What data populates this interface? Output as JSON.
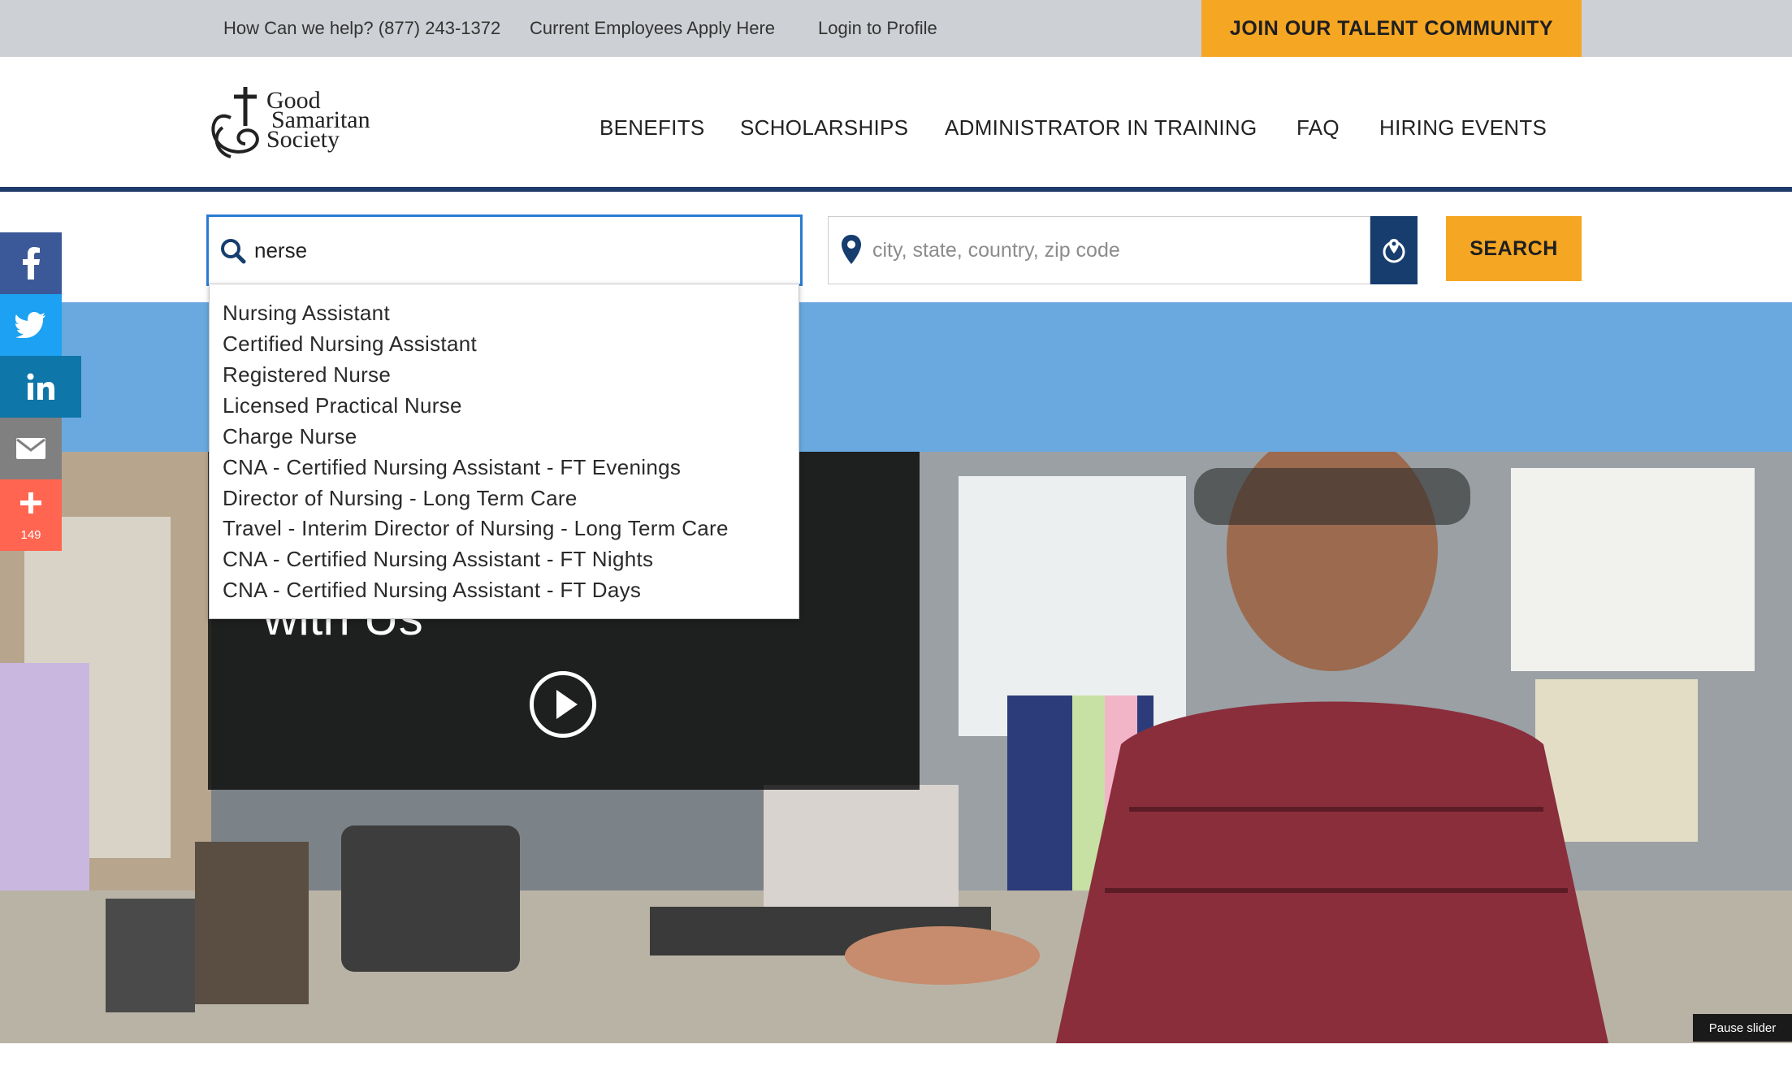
{
  "utility_bar": {
    "help_text": "How Can we help? (877) 243-1372",
    "employees_link": "Current Employees Apply Here",
    "login_link": "Login to Profile",
    "join_button": "JOIN OUR TALENT COMMUNITY"
  },
  "logo": {
    "line1": "Good",
    "line2": "Samaritan",
    "line3": "Society"
  },
  "nav": {
    "items": [
      "BENEFITS",
      "SCHOLARSHIPS",
      "ADMINISTRATOR IN TRAINING",
      "FAQ",
      "HIRING EVENTS"
    ]
  },
  "search": {
    "keyword_value": "nerse",
    "location_placeholder": "city, state, country, zip code",
    "button_label": "SEARCH"
  },
  "suggestions": [
    "Nursing Assistant",
    "Certified Nursing Assistant",
    "Registered Nurse",
    "Licensed Practical Nurse",
    "Charge Nurse",
    "CNA - Certified Nursing Assistant - FT Evenings",
    "Director of Nursing - Long Term Care",
    "Travel - Interim Director of Nursing - Long Term Care",
    "CNA - Certified Nursing Assistant - FT Nights",
    "CNA - Certified Nursing Assistant - FT Days"
  ],
  "hero": {
    "title_fragment": "with Us",
    "pause_label": "Pause slider"
  },
  "social": {
    "share_count": "149",
    "colors": {
      "facebook": "#3b5998",
      "twitter": "#1da1f2",
      "linkedin": "#0e76a8",
      "email": "#808080",
      "more": "#ff6550"
    }
  },
  "colors": {
    "accent": "#f5a623",
    "navy": "#1d3b6a",
    "band": "#6aa9e0"
  }
}
